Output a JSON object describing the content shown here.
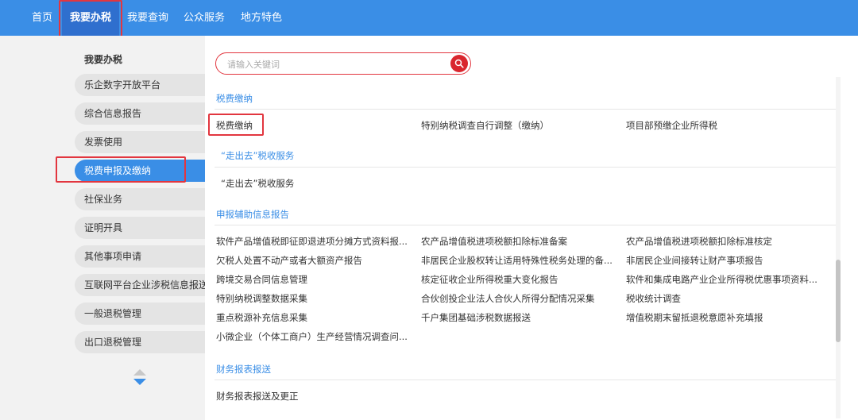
{
  "nav": {
    "items": [
      "首页",
      "我要办税",
      "我要查询",
      "公众服务",
      "地方特色"
    ]
  },
  "sidebar": {
    "title": "我要办税",
    "items": [
      "乐企数字开放平台",
      "综合信息报告",
      "发票使用",
      "税费申报及缴纳",
      "社保业务",
      "证明开具",
      "其他事项申请",
      "互联网平台企业涉税信息报送",
      "一般退税管理",
      "出口退税管理"
    ],
    "active": "税费申报及缴纳"
  },
  "search": {
    "placeholder": "请输入关键词"
  },
  "sections": [
    {
      "title": "税费缴纳",
      "rows": [
        [
          "税费缴纳",
          "特别纳税调查自行调整（缴纳）",
          "项目部预缴企业所得税"
        ]
      ]
    },
    {
      "title": "“走出去”税收服务",
      "rows": [
        [
          "“走出去”税收服务"
        ]
      ]
    },
    {
      "title": "申报辅助信息报告",
      "rows": [
        [
          "软件产品增值税即征即退进项分摊方式资料报...",
          "农产品增值税进项税额扣除标准备案",
          "农产品增值税进项税额扣除标准核定"
        ],
        [
          "欠税人处置不动产或者大额资产报告",
          "非居民企业股权转让适用特殊性税务处理的备...",
          "非居民企业间接转让财产事项报告"
        ],
        [
          "跨境交易合同信息管理",
          "核定征收企业所得税重大变化报告",
          "软件和集成电路产业企业所得税优惠事项资料..."
        ],
        [
          "特别纳税调整数据采集",
          "合伙创投企业法人合伙人所得分配情况采集",
          "税收统计调查"
        ],
        [
          "重点税源补充信息采集",
          "千户集团基础涉税数据报送",
          "增值税期末留抵退税意愿补充填报"
        ],
        [
          "小微企业（个体工商户）生产经营情况调查问..."
        ]
      ]
    },
    {
      "title": "财务报表报送",
      "rows": [
        [
          "财务报表报送及更正"
        ]
      ]
    }
  ],
  "colors": {
    "nav_bg": "#3a8ee6",
    "nav_active": "#2f6fce",
    "highlight": "#e2363f",
    "link_blue": "#3a8ee6"
  }
}
